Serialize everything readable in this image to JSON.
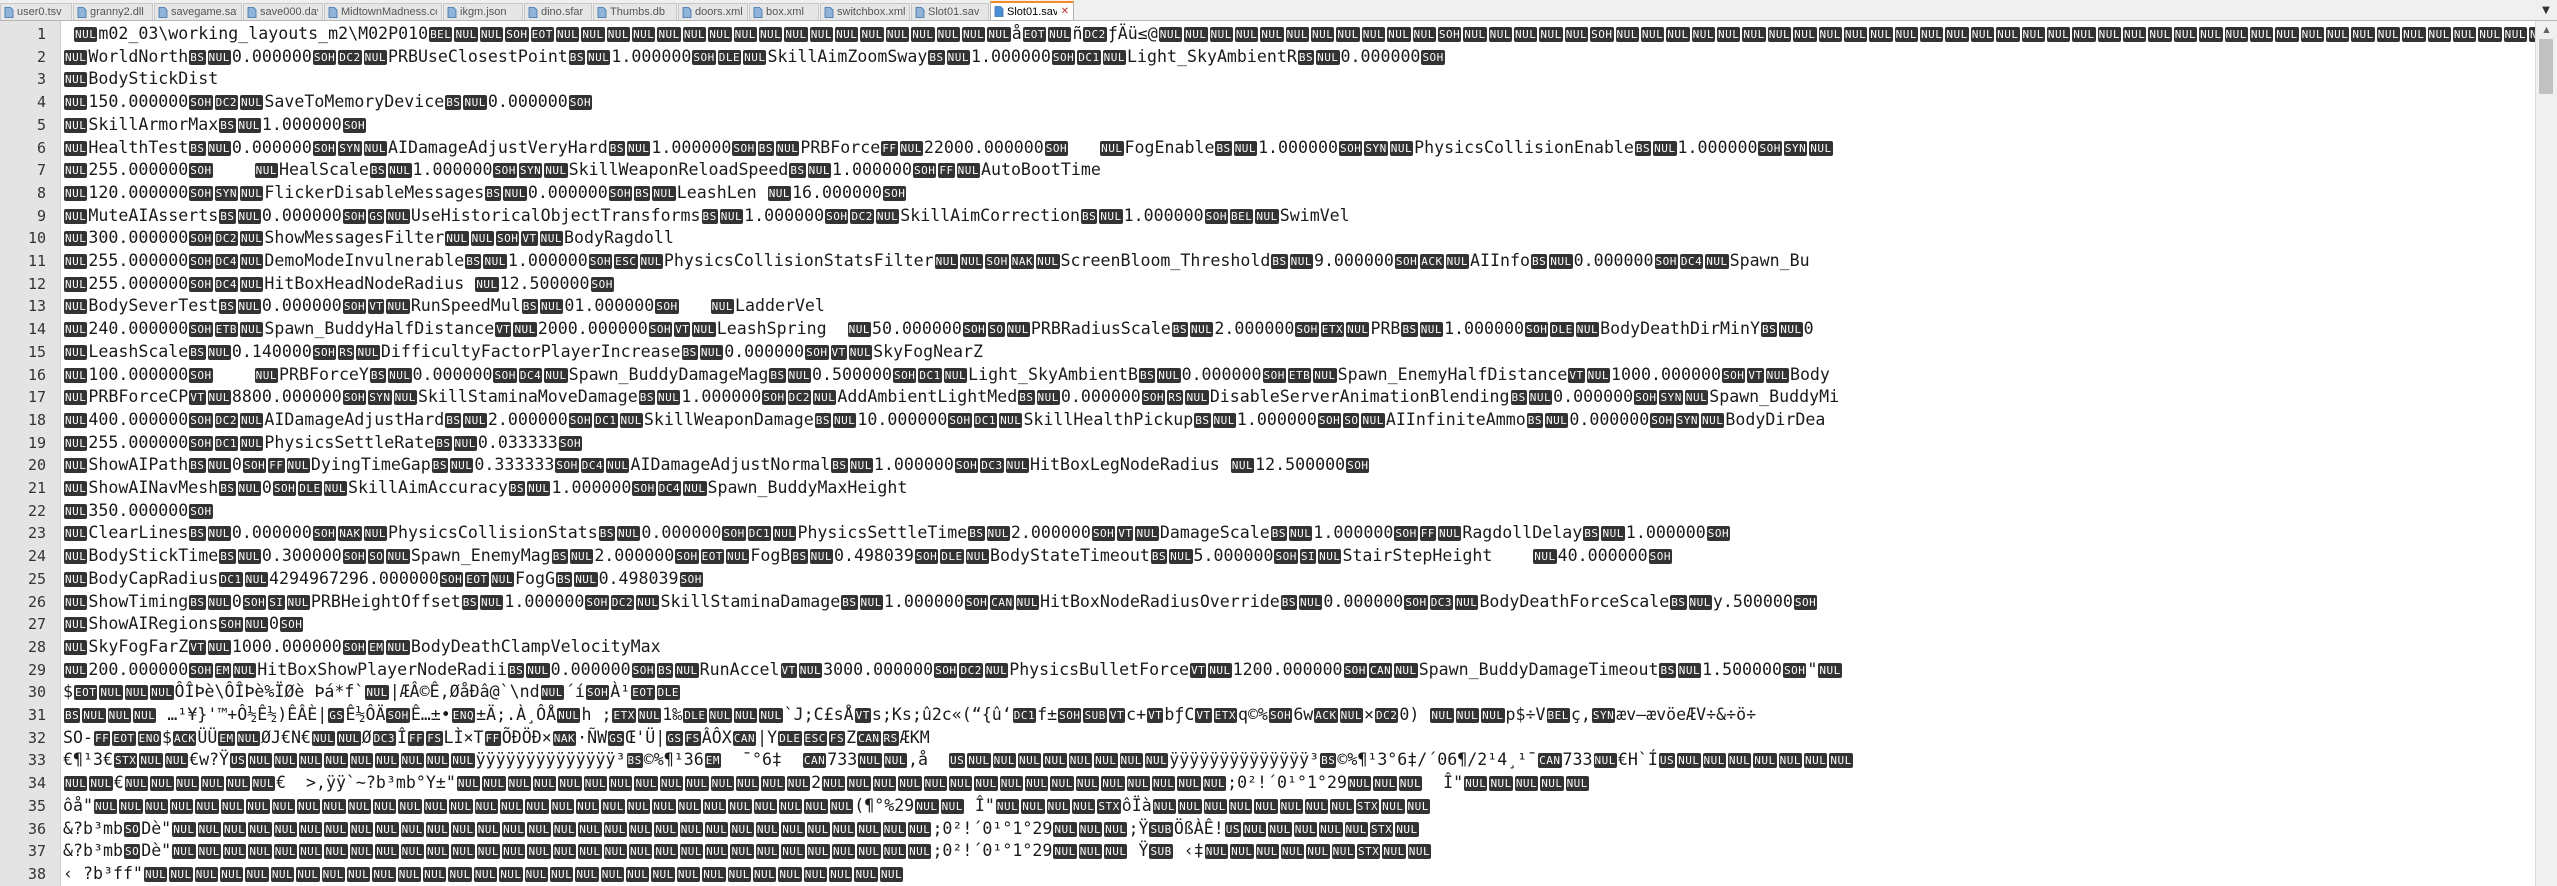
{
  "tabs": [
    {
      "label": "user0.tsv",
      "active": false
    },
    {
      "label": "granny2.dll",
      "active": false
    },
    {
      "label": "savegame.sav",
      "active": false
    },
    {
      "label": "save000.dav",
      "active": false
    },
    {
      "label": "MidtownMadness.cod",
      "active": false
    },
    {
      "label": "ikgm.json",
      "active": false
    },
    {
      "label": "dino.sfar",
      "active": false
    },
    {
      "label": "Thumbs.db",
      "active": false
    },
    {
      "label": "doors.xml",
      "active": false
    },
    {
      "label": "box.xml",
      "active": false
    },
    {
      "label": "switchbox.xml",
      "active": false
    },
    {
      "label": "Slot01.sav",
      "active": false
    },
    {
      "label": "Slot01.sav",
      "active": true
    }
  ],
  "tab_close_glyph": "✕",
  "tab_overflow_glyph": "▼",
  "scroll_up_glyph": "▲",
  "scroll_down_glyph": "▼",
  "colors": {
    "tab_accent": "#f28c28",
    "control_char_bg": "#333333",
    "gutter_bg": "#e4e4e4"
  },
  "lines": [
    {
      "n": "1",
      "text": " ⟦NUL⟧m02_03\\working_layouts_m2\\M02P010⟦BEL⟧⟦NUL⟧⟦NUL⟧⟦SOH⟧⟦EOT⟧⟦NUL⟧⟦NUL⟧⟦NUL⟧⟦NUL⟧⟦NUL⟧⟦NUL⟧⟦NUL⟧⟦NUL⟧⟦NUL⟧⟦NUL⟧⟦NUL⟧⟦NUL⟧⟦NUL⟧⟦NUL⟧⟦NUL⟧⟦NUL⟧⟦NUL⟧⟦NUL⟧å⟦EOT⟧⟦NUL⟧ñ⟦DC2⟧ƒÄü≤@⟦NUL⟧⟦NUL⟧⟦NUL⟧⟦NUL⟧⟦NUL⟧⟦NUL⟧⟦NUL⟧⟦NUL⟧⟦NUL⟧⟦NUL⟧⟦NUL⟧⟦SOH⟧⟦NUL⟧⟦NUL⟧⟦NUL⟧⟦NUL⟧⟦NUL⟧⟦SOH⟧⟦NUL⟧⟦NUL⟧⟦NUL⟧⟦NUL⟧⟦NUL⟧⟦NUL⟧⟦NUL⟧⟦NUL⟧⟦NUL⟧⟦NUL⟧⟦NUL⟧⟦NUL⟧⟦NUL⟧⟦NUL⟧⟦NUL⟧⟦NUL⟧⟦NUL⟧⟦NUL⟧⟦NUL⟧⟦NUL⟧⟦NUL⟧⟦NUL⟧⟦NUL⟧⟦NUL⟧⟦NUL⟧⟦NUL⟧⟦NUL⟧⟦NUL⟧⟦NUL⟧⟦NUL⟧⟦NUL⟧⟦NUL⟧⟦NUL⟧⟦NUL⟧⟦NUL⟧⟦NUL⟧⟦NUL⟧⟦NUL⟧⟦NUL⟧⟦NUL⟧⟦NUL⟧⟦NUL⟧⟦NUL⟧⟦NUL⟧⟦NUL⟧⟦NUL⟧"
    },
    {
      "n": "2",
      "text": "⟦NUL⟧WorldNorth⟦BS⟧⟦NUL⟧0.000000⟦SOH⟧⟦DC2⟧⟦NUL⟧PRBUseClosestPoint⟦BS⟧⟦NUL⟧1.000000⟦SOH⟧⟦DLE⟧⟦NUL⟧SkillAimZoomSway⟦BS⟧⟦NUL⟧1.000000⟦SOH⟧⟦DC1⟧⟦NUL⟧Light_SkyAmbientR⟦BS⟧⟦NUL⟧0.000000⟦SOH⟧"
    },
    {
      "n": "3",
      "text": "⟦NUL⟧BodyStickDist"
    },
    {
      "n": "4",
      "text": "⟦NUL⟧150.000000⟦SOH⟧⟦DC2⟧⟦NUL⟧SaveToMemoryDevice⟦BS⟧⟦NUL⟧0.000000⟦SOH⟧"
    },
    {
      "n": "5",
      "text": "⟦NUL⟧SkillArmorMax⟦BS⟧⟦NUL⟧1.000000⟦SOH⟧"
    },
    {
      "n": "6",
      "text": "⟦NUL⟧HealthTest⟦BS⟧⟦NUL⟧0.000000⟦SOH⟧⟦SYN⟧⟦NUL⟧AIDamageAdjustVeryHard⟦BS⟧⟦NUL⟧1.000000⟦SOH⟧⟦BS⟧⟦NUL⟧PRBForce⟦FF⟧⟦NUL⟧22000.000000⟦SOH⟧   ⟦NUL⟧FogEnable⟦BS⟧⟦NUL⟧1.000000⟦SOH⟧⟦SYN⟧⟦NUL⟧PhysicsCollisionEnable⟦BS⟧⟦NUL⟧1.000000⟦SOH⟧⟦SYN⟧⟦NUL⟧"
    },
    {
      "n": "7",
      "text": "⟦NUL⟧255.000000⟦SOH⟧    ⟦NUL⟧HealScale⟦BS⟧⟦NUL⟧1.000000⟦SOH⟧⟦SYN⟧⟦NUL⟧SkillWeaponReloadSpeed⟦BS⟧⟦NUL⟧1.000000⟦SOH⟧⟦FF⟧⟦NUL⟧AutoBootTime"
    },
    {
      "n": "8",
      "text": "⟦NUL⟧120.000000⟦SOH⟧⟦SYN⟧⟦NUL⟧FlickerDisableMessages⟦BS⟧⟦NUL⟧0.000000⟦SOH⟧⟦BS⟧⟦NUL⟧LeashLen ⟦NUL⟧16.000000⟦SOH⟧"
    },
    {
      "n": "9",
      "text": "⟦NUL⟧MuteAIAsserts⟦BS⟧⟦NUL⟧0.000000⟦SOH⟧⟦GS⟧⟦NUL⟧UseHistoricalObjectTransforms⟦BS⟧⟦NUL⟧1.000000⟦SOH⟧⟦DC2⟧⟦NUL⟧SkillAimCorrection⟦BS⟧⟦NUL⟧1.000000⟦SOH⟧⟦BEL⟧⟦NUL⟧SwimVel"
    },
    {
      "n": "10",
      "text": "⟦NUL⟧300.000000⟦SOH⟧⟦DC2⟧⟦NUL⟧ShowMessagesFilter⟦NUL⟧⟦NUL⟧⟦SOH⟧⟦VT⟧⟦NUL⟧BodyRagdoll"
    },
    {
      "n": "11",
      "text": "⟦NUL⟧255.000000⟦SOH⟧⟦DC4⟧⟦NUL⟧DemoModeInvulnerable⟦BS⟧⟦NUL⟧1.000000⟦SOH⟧⟦ESC⟧⟦NUL⟧PhysicsCollisionStatsFilter⟦NUL⟧⟦NUL⟧⟦SOH⟧⟦NAK⟧⟦NUL⟧ScreenBloom_Threshold⟦BS⟧⟦NUL⟧9.000000⟦SOH⟧⟦ACK⟧⟦NUL⟧AIInfo⟦BS⟧⟦NUL⟧0.000000⟦SOH⟧⟦DC4⟧⟦NUL⟧Spawn_Bu"
    },
    {
      "n": "12",
      "text": "⟦NUL⟧255.000000⟦SOH⟧⟦DC4⟧⟦NUL⟧HitBoxHeadNodeRadius ⟦NUL⟧12.500000⟦SOH⟧"
    },
    {
      "n": "13",
      "text": "⟦NUL⟧BodySeverTest⟦BS⟧⟦NUL⟧0.000000⟦SOH⟧⟦VT⟧⟦NUL⟧RunSpeedMul⟦BS⟧⟦NUL⟧01.000000⟦SOH⟧   ⟦NUL⟧LadderVel"
    },
    {
      "n": "14",
      "text": "⟦NUL⟧240.000000⟦SOH⟧⟦ETB⟧⟦NUL⟧Spawn_BuddyHalfDistance⟦VT⟧⟦NUL⟧2000.000000⟦SOH⟧⟦VT⟧⟦NUL⟧LeashSpring  ⟦NUL⟧50.000000⟦SOH⟧⟦SO⟧⟦NUL⟧PRBRadiusScale⟦BS⟧⟦NUL⟧2.000000⟦SOH⟧⟦ETX⟧⟦NUL⟧PRB⟦BS⟧⟦NUL⟧1.000000⟦SOH⟧⟦DLE⟧⟦NUL⟧BodyDeathDirMinY⟦BS⟧⟦NUL⟧0"
    },
    {
      "n": "15",
      "text": "⟦NUL⟧LeashScale⟦BS⟧⟦NUL⟧0.140000⟦SOH⟧⟦RS⟧⟦NUL⟧DifficultyFactorPlayerIncrease⟦BS⟧⟦NUL⟧0.000000⟦SOH⟧⟦VT⟧⟦NUL⟧SkyFogNearZ"
    },
    {
      "n": "16",
      "text": "⟦NUL⟧100.000000⟦SOH⟧    ⟦NUL⟧PRBForceY⟦BS⟧⟦NUL⟧0.000000⟦SOH⟧⟦DC4⟧⟦NUL⟧Spawn_BuddyDamageMag⟦BS⟧⟦NUL⟧0.500000⟦SOH⟧⟦DC1⟧⟦NUL⟧Light_SkyAmbientB⟦BS⟧⟦NUL⟧0.000000⟦SOH⟧⟦ETB⟧⟦NUL⟧Spawn_EnemyHalfDistance⟦VT⟧⟦NUL⟧1000.000000⟦SOH⟧⟦VT⟧⟦NUL⟧Body"
    },
    {
      "n": "17",
      "text": "⟦NUL⟧PRBForceCP⟦VT⟧⟦NUL⟧8800.000000⟦SOH⟧⟦SYN⟧⟦NUL⟧SkillStaminaMoveDamage⟦BS⟧⟦NUL⟧1.000000⟦SOH⟧⟦DC2⟧⟦NUL⟧AddAmbientLightMed⟦BS⟧⟦NUL⟧0.000000⟦SOH⟧⟦RS⟧⟦NUL⟧DisableServerAnimationBlending⟦BS⟧⟦NUL⟧0.000000⟦SOH⟧⟦SYN⟧⟦NUL⟧Spawn_BuddyMi"
    },
    {
      "n": "18",
      "text": "⟦NUL⟧400.000000⟦SOH⟧⟦DC2⟧⟦NUL⟧AIDamageAdjustHard⟦BS⟧⟦NUL⟧2.000000⟦SOH⟧⟦DC1⟧⟦NUL⟧SkillWeaponDamage⟦BS⟧⟦NUL⟧10.000000⟦SOH⟧⟦DC1⟧⟦NUL⟧SkillHealthPickup⟦BS⟧⟦NUL⟧1.000000⟦SOH⟧⟦SO⟧⟦NUL⟧AIInfiniteAmmo⟦BS⟧⟦NUL⟧0.000000⟦SOH⟧⟦SYN⟧⟦NUL⟧BodyDirDea"
    },
    {
      "n": "19",
      "text": "⟦NUL⟧255.000000⟦SOH⟧⟦DC1⟧⟦NUL⟧PhysicsSettleRate⟦BS⟧⟦NUL⟧0.033333⟦SOH⟧"
    },
    {
      "n": "20",
      "text": "⟦NUL⟧ShowAIPath⟦BS⟧⟦NUL⟧0⟦SOH⟧⟦FF⟧⟦NUL⟧DyingTimeGap⟦BS⟧⟦NUL⟧0.333333⟦SOH⟧⟦DC4⟧⟦NUL⟧AIDamageAdjustNormal⟦BS⟧⟦NUL⟧1.000000⟦SOH⟧⟦DC3⟧⟦NUL⟧HitBoxLegNodeRadius ⟦NUL⟧12.500000⟦SOH⟧"
    },
    {
      "n": "21",
      "text": "⟦NUL⟧ShowAINavMesh⟦BS⟧⟦NUL⟧0⟦SOH⟧⟦DLE⟧⟦NUL⟧SkillAimAccuracy⟦BS⟧⟦NUL⟧1.000000⟦SOH⟧⟦DC4⟧⟦NUL⟧Spawn_BuddyMaxHeight"
    },
    {
      "n": "22",
      "text": "⟦NUL⟧350.000000⟦SOH⟧"
    },
    {
      "n": "23",
      "text": "⟦NUL⟧ClearLines⟦BS⟧⟦NUL⟧0.000000⟦SOH⟧⟦NAK⟧⟦NUL⟧PhysicsCollisionStats⟦BS⟧⟦NUL⟧0.000000⟦SOH⟧⟦DC1⟧⟦NUL⟧PhysicsSettleTime⟦BS⟧⟦NUL⟧2.000000⟦SOH⟧⟦VT⟧⟦NUL⟧DamageScale⟦BS⟧⟦NUL⟧1.000000⟦SOH⟧⟦FF⟧⟦NUL⟧RagdollDelay⟦BS⟧⟦NUL⟧1.000000⟦SOH⟧"
    },
    {
      "n": "24",
      "text": "⟦NUL⟧BodyStickTime⟦BS⟧⟦NUL⟧0.300000⟦SOH⟧⟦SO⟧⟦NUL⟧Spawn_EnemyMag⟦BS⟧⟦NUL⟧2.000000⟦SOH⟧⟦EOT⟧⟦NUL⟧FogB⟦BS⟧⟦NUL⟧0.498039⟦SOH⟧⟦DLE⟧⟦NUL⟧BodyStateTimeout⟦BS⟧⟦NUL⟧5.000000⟦SOH⟧⟦SI⟧⟦NUL⟧StairStepHeight    ⟦NUL⟧40.000000⟦SOH⟧"
    },
    {
      "n": "25",
      "text": "⟦NUL⟧BodyCapRadius⟦DC1⟧⟦NUL⟧4294967296.000000⟦SOH⟧⟦EOT⟧⟦NUL⟧FogG⟦BS⟧⟦NUL⟧0.498039⟦SOH⟧"
    },
    {
      "n": "26",
      "text": "⟦NUL⟧ShowTiming⟦BS⟧⟦NUL⟧0⟦SOH⟧⟦SI⟧⟦NUL⟧PRBHeightOffset⟦BS⟧⟦NUL⟧1.000000⟦SOH⟧⟦DC2⟧⟦NUL⟧SkillStaminaDamage⟦BS⟧⟦NUL⟧1.000000⟦SOH⟧⟦CAN⟧⟦NUL⟧HitBoxNodeRadiusOverride⟦BS⟧⟦NUL⟧0.000000⟦SOH⟧⟦DC3⟧⟦NUL⟧BodyDeathForceScale⟦BS⟧⟦NUL⟧y.500000⟦SOH⟧"
    },
    {
      "n": "27",
      "text": "⟦NUL⟧ShowAIRegions⟦SOH⟧⟦NUL⟧0⟦SOH⟧"
    },
    {
      "n": "28",
      "text": "⟦NUL⟧SkyFogFarZ⟦VT⟧⟦NUL⟧1000.000000⟦SOH⟧⟦EM⟧⟦NUL⟧BodyDeathClampVelocityMax"
    },
    {
      "n": "29",
      "text": "⟦NUL⟧200.000000⟦SOH⟧⟦EM⟧⟦NUL⟧HitBoxShowPlayerNodeRadii⟦BS⟧⟦NUL⟧0.000000⟦SOH⟧⟦BS⟧⟦NUL⟧RunAccel⟦VT⟧⟦NUL⟧3000.000000⟦SOH⟧⟦DC2⟧⟦NUL⟧PhysicsBulletForce⟦VT⟧⟦NUL⟧1200.000000⟦SOH⟧⟦CAN⟧⟦NUL⟧Spawn_BuddyDamageTimeout⟦BS⟧⟦NUL⟧1.500000⟦SOH⟧\"⟦NUL⟧"
    },
    {
      "n": "30",
      "text": "$⟦EOT⟧⟦NUL⟧⟦NUL⟧⟦NUL⟧ÔÎÞè\\ÔÎÞè%ÏØè Þá*f`⟦NUL⟧|ÆÂ©Ê,ØåÐâ@`\\nd⟦NUL⟧´í⟦SOH⟧À¹⟦EOT⟧⟦DLE⟧"
    },
    {
      "n": "31",
      "text": "⟦BS⟧⟦NUL⟧⟦NUL⟧⟦NUL⟧ …¹¥}'™+Ô½Ê½)ÊÂÈ|⟦GS⟧Ê½ÔÄ⟦SOH⟧Ê…±•⟦ENQ⟧±Ä;.À¸ÔÅ⟦NUL⟧h ;⟦ETX⟧⟦NUL⟧1‰⟦DLE⟧⟦NUL⟧⟦NUL⟧⟦NUL⟧`J;C£sÅ⟦VT⟧s;Ks;û2c«(“{û‘⟦DC1⟧f±⟦SOH⟧⟦SUB⟧⟦VT⟧c+⟦VT⟧bƒC⟦VT⟧⟦ETX⟧q©%⟦SOH⟧6w⟦ACK⟧⟦NUL⟧×⟦DC2⟧0) ⟦NUL⟧⟦NUL⟧⟦NUL⟧p$÷V⟦BEL⟧ç,⟦SYN⟧æv–ævöeÆV÷&÷ö÷"
    },
    {
      "n": "32",
      "text": "SO-⟦FF⟧⟦EOT⟧⟦ENO⟧$⟦ACK⟧ÜÜ⟦EM⟧⟦NUL⟧ØJ€N€⟦NUL⟧⟦NUL⟧Ø⟦DC3⟧Î⟦FF⟧⟦FS⟧LÌ×T⟦FF⟧ÕÐÖÐ×⟦NAK⟧·ÑW⟦GS⟧Œ'Ü|⟦GS⟧⟦FS⟧ÂÔX⟦CAN⟧|Y⟦DLE⟧⟦ESC⟧⟦FS⟧Z⟦CAN⟧⟦RS⟧ÆKM"
    },
    {
      "n": "33",
      "text": "€¶¹3€⟦STX⟧⟦NUL⟧⟦NUL⟧€w?Ÿ⟦US⟧⟦NUL⟧⟦NUL⟧⟦NUL⟧⟦NUL⟧⟦NUL⟧⟦NUL⟧⟦NUL⟧⟦NUL⟧⟦NUL⟧ÿÿÿÿÿÿÿÿÿÿÿÿÿÿ³⟦BS⟧©%¶¹36⟦EM⟧  ¯°6‡  ⟦CAN⟧733⟦NUL⟧⟦NUL⟧,å  ⟦US⟧⟦NUL⟧⟦NUL⟧⟦NUL⟧⟦NUL⟧⟦NUL⟧⟦NUL⟧⟦NUL⟧⟦NUL⟧ÿÿÿÿÿÿÿÿÿÿÿÿÿÿ³⟦BS⟧©%¶¹3°6‡/´06¶/2¹4¸¹¯⟦CAN⟧733⟦NUL⟧€H`Í⟦US⟧⟦NUL⟧⟦NUL⟧⟦NUL⟧⟦NUL⟧⟦NUL⟧⟦NUL⟧⟦NUL⟧"
    },
    {
      "n": "34",
      "text": "⟦NUL⟧⟦NUL⟧€⟦NUL⟧⟦NUL⟧⟦NUL⟧⟦NUL⟧⟦NUL⟧⟦NUL⟧€  >,ÿÿ`~?b³mb°Y±\"⟦NUL⟧⟦NUL⟧⟦NUL⟧⟦NUL⟧⟦NUL⟧⟦NUL⟧⟦NUL⟧⟦NUL⟧⟦NUL⟧⟦NUL⟧⟦NUL⟧⟦NUL⟧⟦NUL⟧⟦NUL⟧2⟦NUL⟧⟦NUL⟧⟦NUL⟧⟦NUL⟧⟦NUL⟧⟦NUL⟧⟦NUL⟧⟦NUL⟧⟦NUL⟧⟦NUL⟧⟦NUL⟧⟦NUL⟧⟦NUL⟧⟦NUL⟧⟦NUL⟧⟦NUL⟧;0²!´0¹°1°29⟦NUL⟧⟦NUL⟧⟦NUL⟧  Î\"⟦NUL⟧⟦NUL⟧⟦NUL⟧⟦NUL⟧⟦NUL⟧"
    },
    {
      "n": "35",
      "text": "ôå\"⟦NUL⟧⟦NUL⟧⟦NUL⟧⟦NUL⟧⟦NUL⟧⟦NUL⟧⟦NUL⟧⟦NUL⟧⟦NUL⟧⟦NUL⟧⟦NUL⟧⟦NUL⟧⟦NUL⟧⟦NUL⟧⟦NUL⟧⟦NUL⟧⟦NUL⟧⟦NUL⟧⟦NUL⟧⟦NUL⟧⟦NUL⟧⟦NUL⟧⟦NUL⟧⟦NUL⟧⟦NUL⟧⟦NUL⟧⟦NUL⟧⟦NUL⟧⟦NUL⟧⟦NUL⟧(¶°%29⟦NUL⟧⟦NUL⟧ Î\"⟦NUL⟧⟦NUL⟧⟦NUL⟧⟦NUL⟧⟦STX⟧ôÏà⟦NUL⟧⟦NUL⟧⟦NUL⟧⟦NUL⟧⟦NUL⟧⟦NUL⟧⟦NUL⟧⟦NUL⟧⟦STX⟧⟦NUL⟧⟦NUL⟧"
    },
    {
      "n": "36",
      "text": "&?b³mb⟦SO⟧Dè\"⟦NUL⟧⟦NUL⟧⟦NUL⟧⟦NUL⟧⟦NUL⟧⟦NUL⟧⟦NUL⟧⟦NUL⟧⟦NUL⟧⟦NUL⟧⟦NUL⟧⟦NUL⟧⟦NUL⟧⟦NUL⟧⟦NUL⟧⟦NUL⟧⟦NUL⟧⟦NUL⟧⟦NUL⟧⟦NUL⟧⟦NUL⟧⟦NUL⟧⟦NUL⟧⟦NUL⟧⟦NUL⟧⟦NUL⟧⟦NUL⟧⟦NUL⟧⟦NUL⟧⟦NUL⟧;0²!´0¹°1°29⟦NUL⟧⟦NUL⟧⟦NUL⟧;Ÿ⟦SUB⟧ÖßÀÊ!⟦US⟧⟦NUL⟧⟦NUL⟧⟦NUL⟧⟦NUL⟧⟦NUL⟧⟦STX⟧⟦NUL⟧"
    },
    {
      "n": "37",
      "text": "&?b³mb⟦SO⟧Dè\"⟦NUL⟧⟦NUL⟧⟦NUL⟧⟦NUL⟧⟦NUL⟧⟦NUL⟧⟦NUL⟧⟦NUL⟧⟦NUL⟧⟦NUL⟧⟦NUL⟧⟦NUL⟧⟦NUL⟧⟦NUL⟧⟦NUL⟧⟦NUL⟧⟦NUL⟧⟦NUL⟧⟦NUL⟧⟦NUL⟧⟦NUL⟧⟦NUL⟧⟦NUL⟧⟦NUL⟧⟦NUL⟧⟦NUL⟧⟦NUL⟧⟦NUL⟧⟦NUL⟧⟦NUL⟧;0²!´0¹°1°29⟦NUL⟧⟦NUL⟧⟦NUL⟧ Ÿ⟦SUB⟧ ‹‡⟦NUL⟧⟦NUL⟧⟦NUL⟧⟦NUL⟧⟦NUL⟧⟦NUL⟧⟦STX⟧⟦NUL⟧⟦NUL⟧"
    },
    {
      "n": "38",
      "text": "‹ ?b³ff\"⟦NUL⟧⟦NUL⟧⟦NUL⟧⟦NUL⟧⟦NUL⟧⟦NUL⟧⟦NUL⟧⟦NUL⟧⟦NUL⟧⟦NUL⟧⟦NUL⟧⟦NUL⟧⟦NUL⟧⟦NUL⟧⟦NUL⟧⟦NUL⟧⟦NUL⟧⟦NUL⟧⟦NUL⟧⟦NUL⟧⟦NUL⟧⟦NUL⟧⟦NUL⟧⟦NUL⟧⟦NUL⟧⟦NUL⟧⟦NUL⟧⟦NUL⟧⟦NUL⟧⟦NUL⟧"
    }
  ]
}
